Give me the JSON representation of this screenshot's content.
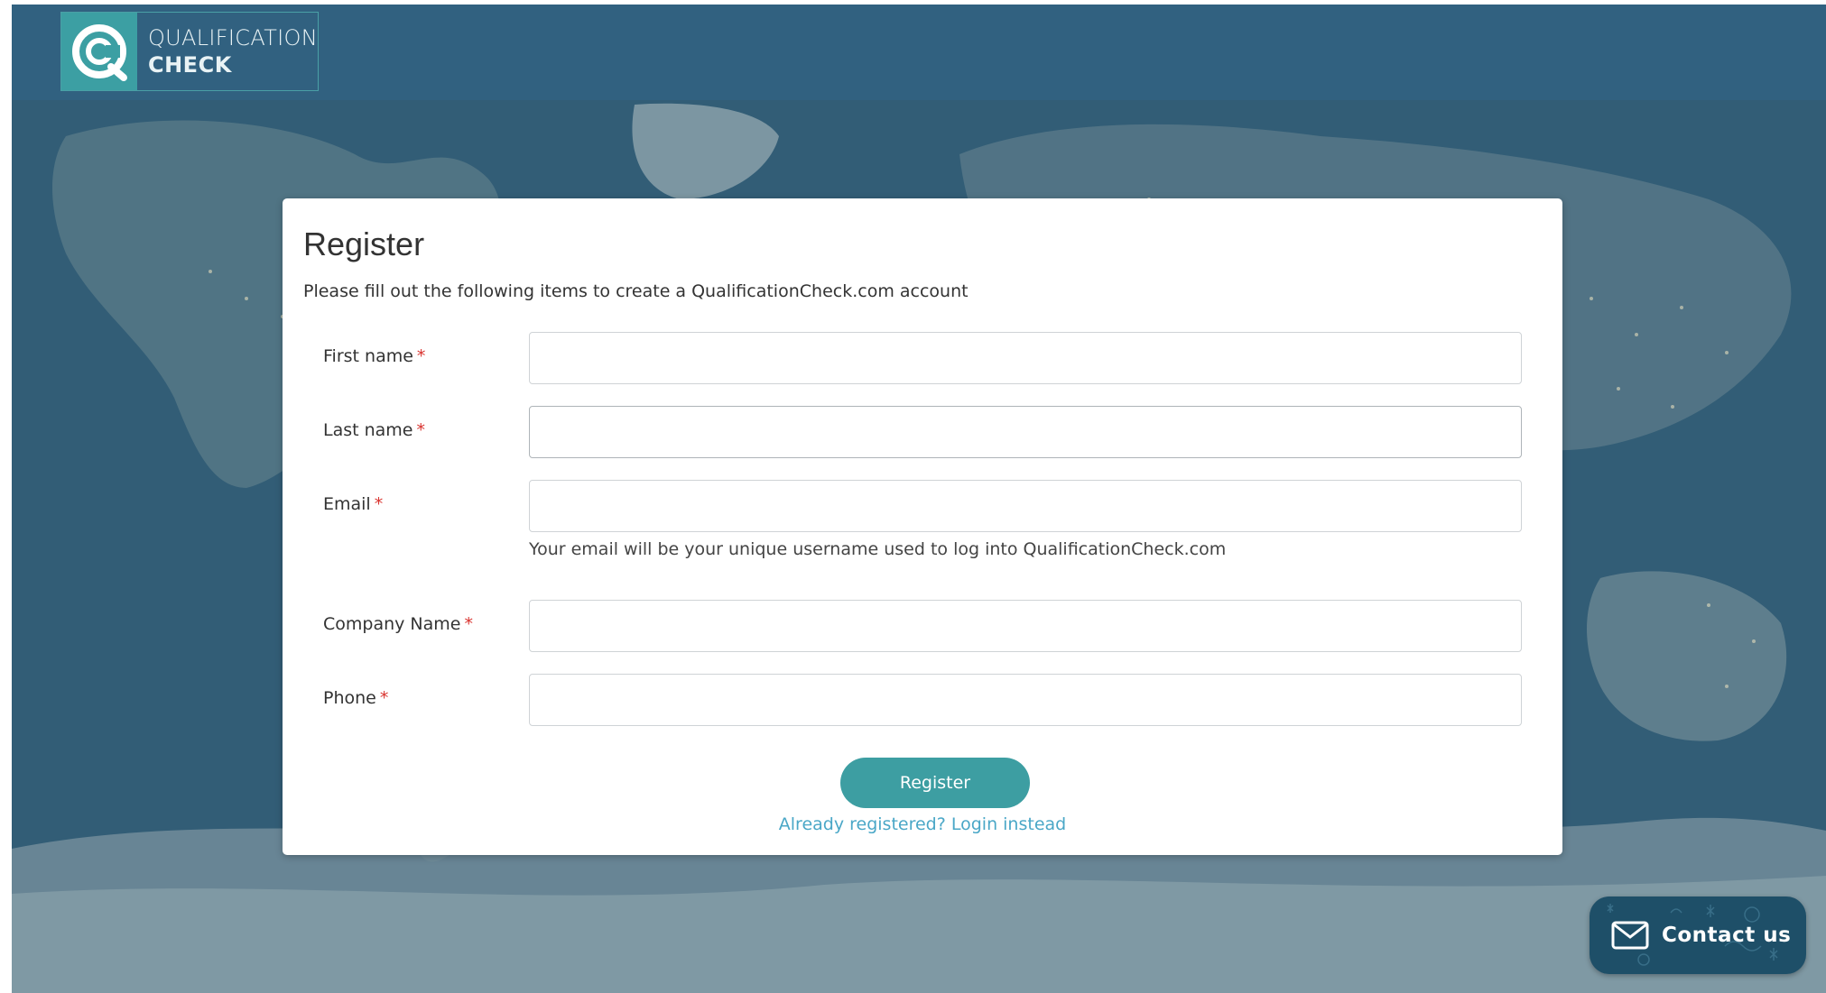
{
  "brand": {
    "line1": "QUALIFICATION",
    "line2": "CHECK",
    "logo_icon": "q-check-logo-icon",
    "accent_color": "#3c9fa3"
  },
  "form": {
    "title": "Register",
    "subtitle": "Please fill out the following items to create a QualificationCheck.com account",
    "required_marker": "*",
    "fields": [
      {
        "label": "First name",
        "value": "",
        "placeholder": ""
      },
      {
        "label": "Last name",
        "value": "",
        "placeholder": ""
      },
      {
        "label": "Email",
        "value": "",
        "placeholder": ""
      },
      {
        "label": "Company Name",
        "value": "",
        "placeholder": ""
      },
      {
        "label": "Phone",
        "value": "",
        "placeholder": ""
      }
    ],
    "email_help": "Your email will be your unique username used to log into QualificationCheck.com",
    "submit_label": "Register",
    "login_link": "Already registered? Login instead"
  },
  "contact": {
    "label": "Contact us",
    "icon": "envelope-icon"
  },
  "colors": {
    "header_bg": "#316180",
    "button_bg": "#3d9ea2",
    "link": "#4aa7c7",
    "required": "#d9332f"
  }
}
